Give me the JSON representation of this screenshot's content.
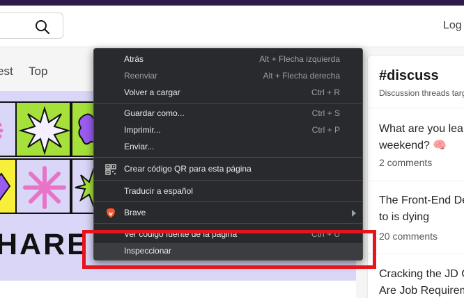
{
  "header": {
    "login_label": "Log"
  },
  "tabs": {
    "latest": "est",
    "top": "Top"
  },
  "banner": {
    "text": "HARE"
  },
  "sidebar": {
    "title": "#discuss",
    "subtitle": "Discussion threads targ",
    "items": [
      {
        "title_line1": "What are you lear",
        "title_line2": "weekend? 🧠",
        "meta": "2 comments"
      },
      {
        "title_line1": "The Front-End De",
        "title_line2": "to is dying",
        "meta": "20 comments"
      },
      {
        "title_line1": "Cracking the JD C",
        "title_line2": "Are Job Requirem",
        "meta": ""
      }
    ]
  },
  "context_menu": {
    "items": [
      {
        "label": "Atrás",
        "shortcut": "Alt + Flecha izquierda",
        "disabled": false
      },
      {
        "label": "Reenviar",
        "shortcut": "Alt + Flecha derecha",
        "disabled": true
      },
      {
        "label": "Volver a cargar",
        "shortcut": "Ctrl + R",
        "disabled": false
      },
      {
        "label": "Guardar como...",
        "shortcut": "Ctrl + S",
        "disabled": false
      },
      {
        "label": "Imprimir...",
        "shortcut": "Ctrl + P",
        "disabled": false
      },
      {
        "label": "Enviar...",
        "shortcut": "",
        "disabled": false
      },
      {
        "label": "Crear código QR para esta página",
        "shortcut": "",
        "icon": "qr-code-icon"
      },
      {
        "label": "Traducir a español",
        "shortcut": ""
      },
      {
        "label": "Brave",
        "shortcut": "",
        "icon": "brave-lion-icon",
        "submenu": true
      },
      {
        "label": "Ver código fuente de la página",
        "shortcut": "Ctrl + U"
      },
      {
        "label": "Inspeccionar",
        "shortcut": "",
        "highlighted": true
      }
    ]
  },
  "colors": {
    "menu_bg": "#292a2d",
    "highlight_box": "#e8141b",
    "banner_bg": "#d9d6f7",
    "top_strip": "#2d1b4e"
  }
}
